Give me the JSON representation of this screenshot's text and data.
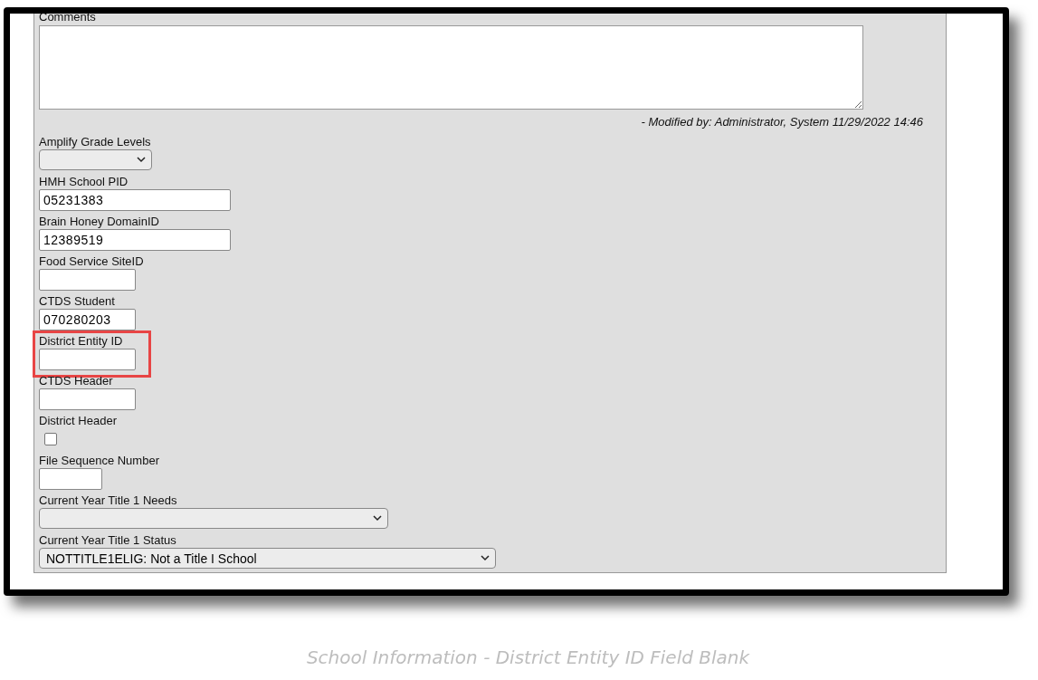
{
  "form": {
    "comments": {
      "label": "Comments",
      "modified_note": "- Modified by: Administrator, System 11/29/2022 14:46"
    },
    "fields": [
      {
        "kind": "select",
        "label": "Amplify Grade Levels",
        "highlighted": false
      },
      {
        "kind": "text",
        "label": "HMH School PID",
        "value": "05231383",
        "highlighted": false
      },
      {
        "kind": "text",
        "label": "Brain Honey DomainID",
        "value": "12389519",
        "highlighted": false
      },
      {
        "kind": "text",
        "label": "Food Service SiteID",
        "highlighted": false
      },
      {
        "kind": "text",
        "label": "CTDS Student",
        "value": "070280203",
        "highlighted": false
      },
      {
        "kind": "text",
        "label": "District Entity ID",
        "highlighted": true
      },
      {
        "kind": "text",
        "label": "CTDS Header",
        "highlighted": false
      },
      {
        "kind": "checkbox",
        "label": "District Header",
        "checked": false,
        "highlighted": false
      },
      {
        "kind": "text",
        "label": "File Sequence Number",
        "highlighted": false
      },
      {
        "kind": "select",
        "label": "Current Year Title 1 Needs",
        "highlighted": false
      },
      {
        "kind": "select",
        "label": "Current Year Title 1 Status",
        "value": "NOTTITLE1ELIG: Not a Title I School",
        "highlighted": false
      }
    ]
  },
  "caption": "School Information - District Entity ID Field Blank"
}
